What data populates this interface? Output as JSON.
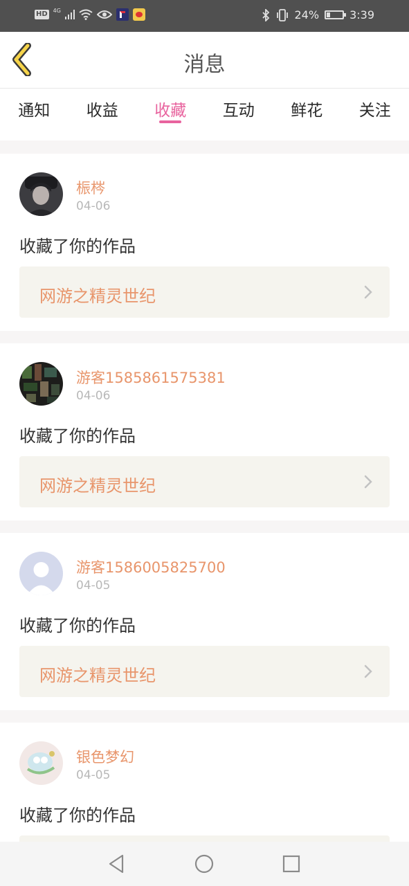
{
  "status_bar": {
    "hd": "HD",
    "network": "4G",
    "battery_percent": "24%",
    "battery_level": 0.24,
    "time": "3:39",
    "icons": [
      "signal-icon",
      "wifi-icon",
      "eye-icon",
      "app-notification-icon",
      "weibo-icon",
      "bluetooth-icon",
      "vibrate-icon",
      "battery-icon"
    ]
  },
  "header": {
    "title": "消息",
    "back_icon": "chevron-left-icon"
  },
  "tabs": [
    {
      "label": "通知",
      "active": false
    },
    {
      "label": "收益",
      "active": false
    },
    {
      "label": "收藏",
      "active": true
    },
    {
      "label": "互动",
      "active": false
    },
    {
      "label": "鲜花",
      "active": false
    },
    {
      "label": "关注",
      "active": false
    }
  ],
  "colors": {
    "accent": "#e8639e",
    "username": "#e8956b",
    "link_bg": "#f5f4ee"
  },
  "feed": [
    {
      "username": "桭梣",
      "date": "04-06",
      "action": "收藏了你的作品",
      "work_title": "网游之精灵世纪",
      "avatar": "dark-portrait"
    },
    {
      "username": "游客1585861575381",
      "date": "04-06",
      "action": "收藏了你的作品",
      "work_title": "网游之精灵世纪",
      "avatar": "dark-collage"
    },
    {
      "username": "游客1586005825700",
      "date": "04-05",
      "action": "收藏了你的作品",
      "work_title": "网游之精灵世纪",
      "avatar": "default-user"
    },
    {
      "username": "银色梦幻",
      "date": "04-05",
      "action": "收藏了你的作品",
      "work_title": "",
      "avatar": "cartoon"
    }
  ],
  "nav_bar": {
    "buttons": [
      "back-triangle-icon",
      "home-circle-icon",
      "recents-square-icon"
    ]
  }
}
